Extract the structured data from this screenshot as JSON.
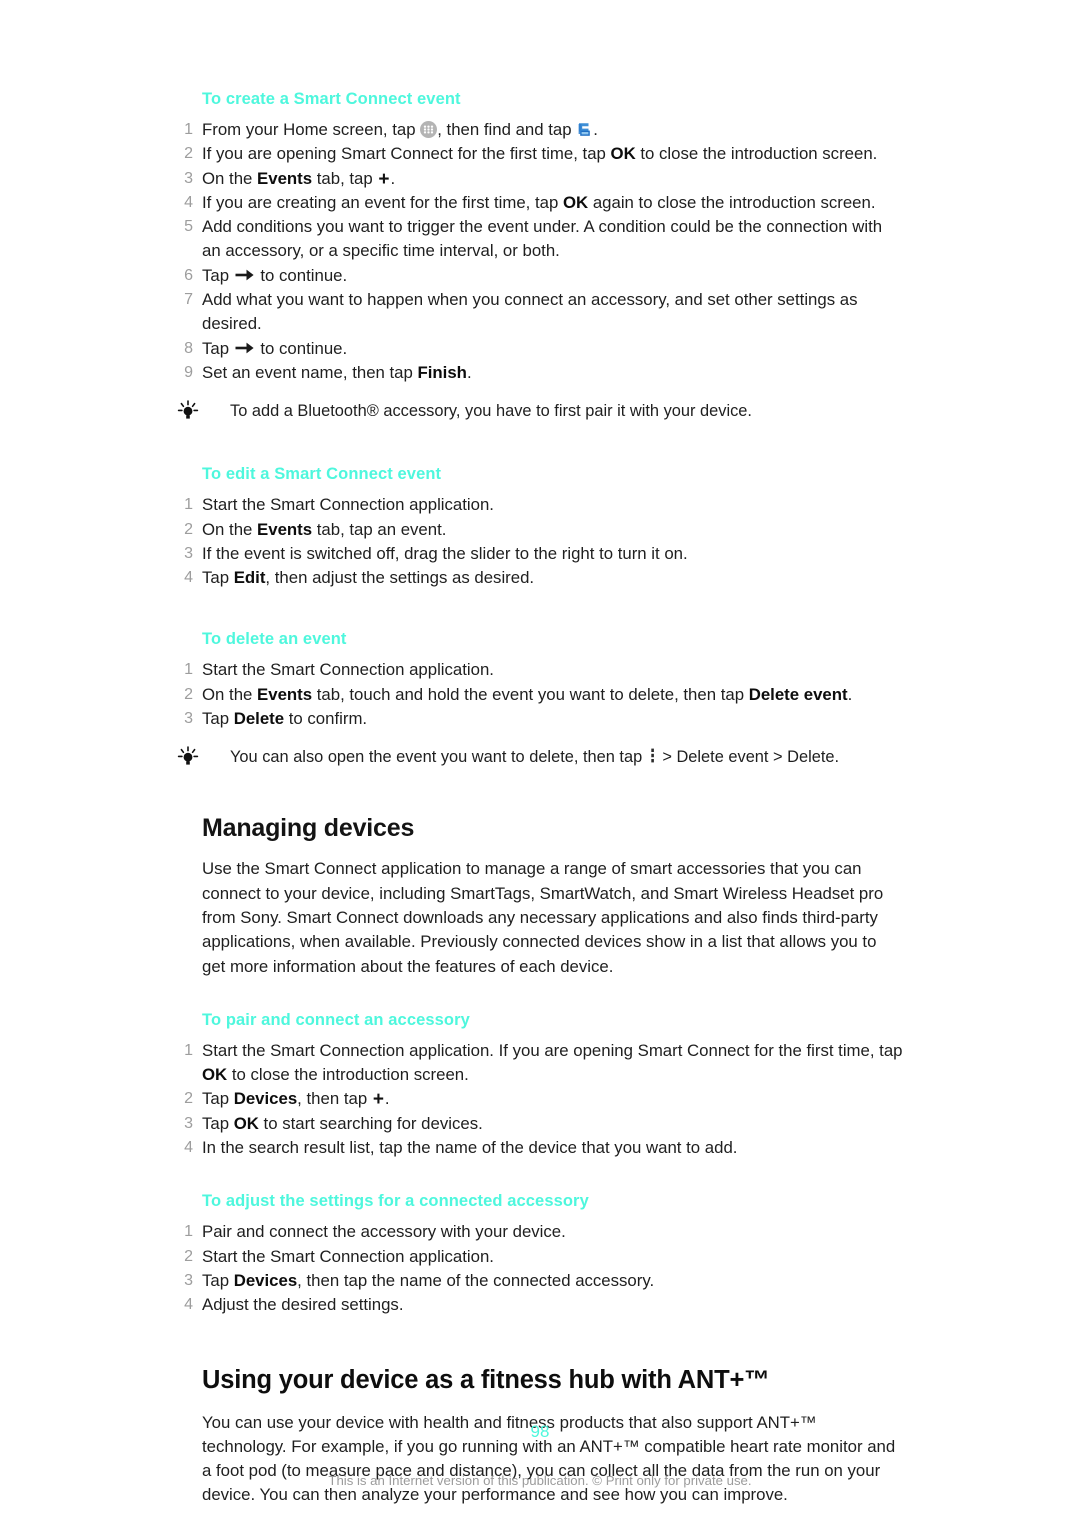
{
  "document": {
    "page_number": "98",
    "footer_note": "This is an Internet version of this publication. © Print only for private use.",
    "accent_color": "#4ef7dd",
    "number_color": "#9d9d9d"
  },
  "sections": {
    "create_event": {
      "heading": "To create a Smart Connect event",
      "steps": [
        {
          "num": "1",
          "parts": [
            {
              "t": "From your Home screen, tap "
            },
            {
              "icon": "app-drawer-icon"
            },
            {
              "t": ", then find and tap "
            },
            {
              "icon": "smart-connect-app-icon"
            },
            {
              "t": "."
            }
          ]
        },
        {
          "num": "2",
          "parts": [
            {
              "t": "If you are opening Smart Connect for the first time, tap "
            },
            {
              "b": "OK"
            },
            {
              "t": " to close the introduction screen."
            }
          ]
        },
        {
          "num": "3",
          "parts": [
            {
              "t": "On the "
            },
            {
              "b": "Events"
            },
            {
              "t": " tab, tap "
            },
            {
              "icon": "plus-icon"
            },
            {
              "t": "."
            }
          ]
        },
        {
          "num": "4",
          "parts": [
            {
              "t": "If you are creating an event for the first time, tap "
            },
            {
              "b": "OK"
            },
            {
              "t": " again to close the introduction screen."
            }
          ]
        },
        {
          "num": "5",
          "parts": [
            {
              "t": "Add conditions you want to trigger the event under. A condition could be the connection with an accessory, or a specific time interval, or both."
            }
          ]
        },
        {
          "num": "6",
          "parts": [
            {
              "t": "Tap "
            },
            {
              "icon": "arrow-right-icon"
            },
            {
              "t": " to continue."
            }
          ]
        },
        {
          "num": "7",
          "parts": [
            {
              "t": "Add what you want to happen when you connect an accessory, and set other settings as desired."
            }
          ]
        },
        {
          "num": "8",
          "parts": [
            {
              "t": "Tap "
            },
            {
              "icon": "arrow-right-icon"
            },
            {
              "t": " to continue."
            }
          ]
        },
        {
          "num": "9",
          "parts": [
            {
              "t": "Set an event name, then tap "
            },
            {
              "b": "Finish"
            },
            {
              "t": "."
            }
          ]
        }
      ],
      "tip": "To add a Bluetooth® accessory, you have to first pair it with your device."
    },
    "edit_event": {
      "heading": "To edit a Smart Connect event",
      "steps": [
        {
          "num": "1",
          "parts": [
            {
              "t": "Start the Smart Connection application."
            }
          ]
        },
        {
          "num": "2",
          "parts": [
            {
              "t": "On the "
            },
            {
              "b": "Events"
            },
            {
              "t": " tab, tap an event."
            }
          ]
        },
        {
          "num": "3",
          "parts": [
            {
              "t": "If the event is switched off, drag the slider to the right to turn it on."
            }
          ]
        },
        {
          "num": "4",
          "parts": [
            {
              "t": "Tap "
            },
            {
              "b": "Edit"
            },
            {
              "t": ", then adjust the settings as desired."
            }
          ]
        }
      ]
    },
    "delete_event": {
      "heading": "To delete an event",
      "steps": [
        {
          "num": "1",
          "parts": [
            {
              "t": "Start the Smart Connection application."
            }
          ]
        },
        {
          "num": "2",
          "parts": [
            {
              "t": "On the "
            },
            {
              "b": "Events"
            },
            {
              "t": " tab, touch and hold the event you want to delete, then tap "
            },
            {
              "b": "Delete event"
            },
            {
              "t": "."
            }
          ]
        },
        {
          "num": "3",
          "parts": [
            {
              "t": "Tap "
            },
            {
              "b": "Delete"
            },
            {
              "t": " to confirm."
            }
          ]
        }
      ],
      "tip_parts": [
        {
          "t": "You can also open the event you want to delete, then tap "
        },
        {
          "icon": "overflow-menu-icon"
        },
        {
          "t": " > Delete event > Delete."
        }
      ]
    },
    "managing_devices": {
      "heading": "Managing devices",
      "body": "Use the Smart Connect application to manage a range of smart accessories that you can connect to your device, including SmartTags, SmartWatch, and Smart Wireless Headset pro from Sony. Smart Connect downloads any necessary applications and also finds third-party applications, when available. Previously connected devices show in a list that allows you to get more information about the features of each device."
    },
    "pair_accessory": {
      "heading": "To pair and connect an accessory",
      "steps": [
        {
          "num": "1",
          "parts": [
            {
              "t": "Start the Smart Connection application. If you are opening Smart Connect for the first time, tap "
            },
            {
              "b": "OK"
            },
            {
              "t": " to close the introduction screen."
            }
          ]
        },
        {
          "num": "2",
          "parts": [
            {
              "t": "Tap "
            },
            {
              "b": "Devices"
            },
            {
              "t": ", then tap "
            },
            {
              "icon": "plus-icon"
            },
            {
              "t": "."
            }
          ]
        },
        {
          "num": "3",
          "parts": [
            {
              "t": "Tap "
            },
            {
              "b": "OK"
            },
            {
              "t": " to start searching for devices."
            }
          ]
        },
        {
          "num": "4",
          "parts": [
            {
              "t": "In the search result list, tap the name of the device that you want to add."
            }
          ]
        }
      ]
    },
    "adjust_settings": {
      "heading": "To adjust the settings for a connected accessory",
      "steps": [
        {
          "num": "1",
          "parts": [
            {
              "t": "Pair and connect the accessory with your device."
            }
          ]
        },
        {
          "num": "2",
          "parts": [
            {
              "t": "Start the Smart Connection application."
            }
          ]
        },
        {
          "num": "3",
          "parts": [
            {
              "t": "Tap "
            },
            {
              "b": "Devices"
            },
            {
              "t": ", then tap the name of the connected accessory."
            }
          ]
        },
        {
          "num": "4",
          "parts": [
            {
              "t": "Adjust the desired settings."
            }
          ]
        }
      ]
    },
    "ant_plus": {
      "heading": "Using your device as a fitness hub with ANT+™",
      "body": "You can use your device with health and fitness products that also support ANT+™ technology. For example, if you go running with an ANT+™ compatible heart rate monitor and a foot pod (to measure pace and distance), you can collect all the data from the run on your device. You can then analyze your performance and see how you can improve."
    }
  }
}
